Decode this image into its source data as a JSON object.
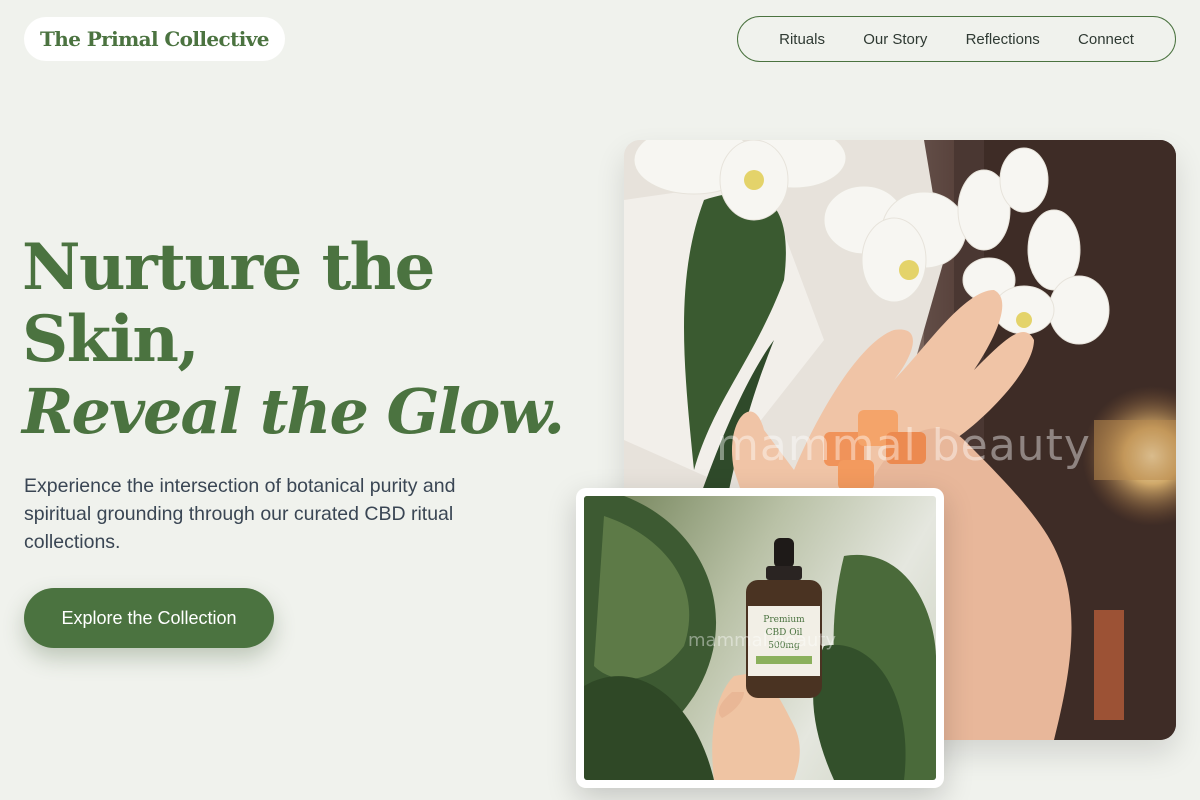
{
  "brand": {
    "name": "The Primal Collective"
  },
  "nav": {
    "items": [
      "Rituals",
      "Our Story",
      "Reflections",
      "Connect"
    ]
  },
  "hero": {
    "headline_line1": "Nurture the",
    "headline_line2": "Skin,",
    "headline_line3": "Reveal the Glow.",
    "description": "Experience the intersection of botanical purity and spiritual grounding through our curated CBD ritual collections.",
    "cta_label": "Explore the Collection"
  },
  "images": {
    "main_watermark": "mammal beauty",
    "product_watermark": "mammal beauty",
    "bottle_label_line1": "Premium",
    "bottle_label_line2": "CBD Oil",
    "bottle_label_line3": "500mg"
  },
  "colors": {
    "accent": "#4b7340",
    "background": "#f0f2ed",
    "text": "#3a4654"
  }
}
